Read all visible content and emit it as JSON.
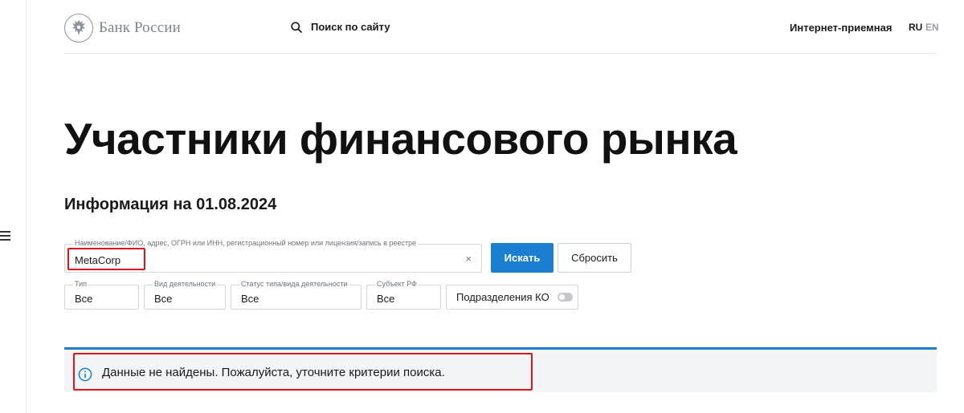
{
  "header": {
    "logo_text": "Банк России",
    "search_label": "Поиск по сайту",
    "reception_label": "Интернет-приемная",
    "lang_ru": "RU",
    "lang_en": "EN"
  },
  "page": {
    "title": "Участники финансового рынка",
    "info_date": "Информация на 01.08.2024"
  },
  "search": {
    "label": "Наименование/ФИО, адрес, ОГРН или ИНН, регистрационный номер или лицензия/запись в реестре",
    "value": "MetaCorp",
    "clear_symbol": "×",
    "submit_label": "Искать",
    "reset_label": "Сбросить"
  },
  "filters": {
    "type": {
      "label": "Тип",
      "value": "Все"
    },
    "activity": {
      "label": "Вид деятельности",
      "value": "Все"
    },
    "status": {
      "label": "Статус типа/вида деятельности",
      "value": "Все"
    },
    "region": {
      "label": "Субъект РФ",
      "value": "Все"
    },
    "subdivisions": {
      "label": "Подразделения КО",
      "enabled": false
    }
  },
  "alert": {
    "message": "Данные не найдены. Пожалуйста, уточните критерии поиска."
  },
  "colors": {
    "accent": "#1a7fd1",
    "annotation": "#e0141c",
    "alert_bg": "#f3f4f5"
  },
  "icons": [
    "menu-icon",
    "bank-emblem-icon",
    "search-icon",
    "close-icon",
    "info-icon"
  ]
}
